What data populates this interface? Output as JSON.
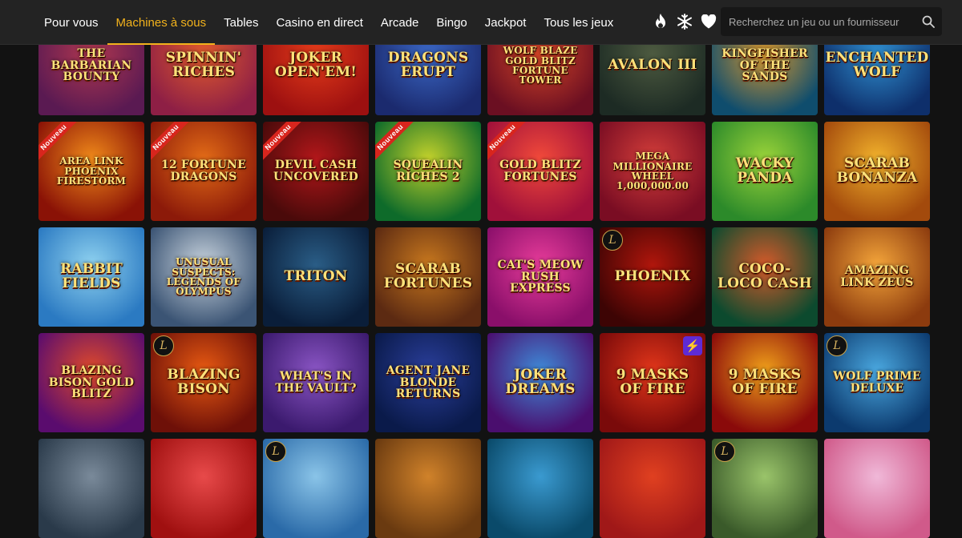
{
  "nav": {
    "items": [
      {
        "label": "Pour vous",
        "active": false
      },
      {
        "label": "Machines à sous",
        "active": true
      },
      {
        "label": "Tables",
        "active": false
      },
      {
        "label": "Casino en direct",
        "active": false
      },
      {
        "label": "Arcade",
        "active": false
      },
      {
        "label": "Bingo",
        "active": false
      },
      {
        "label": "Jackpot",
        "active": false
      },
      {
        "label": "Tous les jeux",
        "active": false
      }
    ]
  },
  "header_icons": [
    "flame-icon",
    "snowflake-icon",
    "heart-icon"
  ],
  "search": {
    "placeholder": "Recherchez un jeu ou un fournisseur",
    "icon": "search-icon"
  },
  "accent_color": "#f2b21c",
  "games": [
    {
      "title": "The Barbarian Bounty",
      "badge": "",
      "bg": "#5a1a52,#b0374f"
    },
    {
      "title": "Spinnin' Riches",
      "badge": "",
      "bg": "#8e1f45,#e05a2c"
    },
    {
      "title": "Joker Open'Em!",
      "badge": "",
      "bg": "#9d1010,#e33b1a"
    },
    {
      "title": "Dragons Erupt",
      "badge": "",
      "bg": "#1b2a6e,#3a66c4"
    },
    {
      "title": "Wolf Blaze Gold Blitz Fortune Tower",
      "badge": "",
      "bg": "#6b0f22,#d24426"
    },
    {
      "title": "Avalon III",
      "badge": "",
      "bg": "#1d2b24,#4d5a40"
    },
    {
      "title": "Kingfisher of the Sands",
      "badge": "",
      "bg": "#0f4d6d,#d8982e"
    },
    {
      "title": "Enchanted Wolf",
      "badge": "",
      "bg": "#0e2f6b,#2f8fd0"
    },
    {
      "title": "Area Link Phoenix Firestorm",
      "badge": "Nouveau",
      "bg": "#8a1206,#f08a1a"
    },
    {
      "title": "12 Fortune Dragons",
      "badge": "Nouveau",
      "bg": "#8c1a09,#e36c17"
    },
    {
      "title": "Devil Cash Uncovered",
      "badge": "Nouveau",
      "bg": "#4a0a0a,#b3171a"
    },
    {
      "title": "Squealin Riches 2",
      "badge": "Nouveau",
      "bg": "#0e6b2a,#c4d22b"
    },
    {
      "title": "Gold Blitz Fortunes",
      "badge": "Nouveau",
      "bg": "#a0103a,#f24a3a"
    },
    {
      "title": "Mega Millionaire Wheel 1,000,000.00",
      "badge": "",
      "bg": "#7a0d23,#d43e3a"
    },
    {
      "title": "Wacky Panda",
      "badge": "",
      "bg": "#2c8a2a,#9bd43a"
    },
    {
      "title": "Scarab Bonanza",
      "badge": "",
      "bg": "#a34a0c,#f2b22c"
    },
    {
      "title": "Rabbit Fields",
      "badge": "",
      "bg": "#2b7ac2,#8fd2f0"
    },
    {
      "title": "Unusual Suspects: Legends of Olympus",
      "badge": "",
      "bg": "#3b5474,#c9d4de"
    },
    {
      "title": "Triton",
      "badge": "",
      "bg": "#0a1e3a,#2a5d86"
    },
    {
      "title": "Scarab Fortunes",
      "badge": "",
      "bg": "#5c2a12,#c8781e"
    },
    {
      "title": "Cat's Meow Rush Express",
      "badge": "",
      "bg": "#8a0f6a,#e83c9a"
    },
    {
      "title": "Phoenix",
      "badge": "L",
      "bg": "#3d0404,#b0160c"
    },
    {
      "title": "Coco-Loco Cash",
      "badge": "",
      "bg": "#0c4a2e,#d45a2a"
    },
    {
      "title": "Amazing Link Zeus",
      "badge": "",
      "bg": "#8c3b0e,#f4a53a"
    },
    {
      "title": "Blazing Bison Gold Blitz",
      "badge": "",
      "bg": "#5a0c6e,#e04a2a"
    },
    {
      "title": "Blazing Bison",
      "badge": "L",
      "bg": "#6e1008,#e85a12"
    },
    {
      "title": "What's in the Vault?",
      "badge": "",
      "bg": "#3b1a6e,#8a55c4"
    },
    {
      "title": "Agent Jane Blonde Returns",
      "badge": "",
      "bg": "#0a1a4a,#2a3e9a"
    },
    {
      "title": "Joker Dreams",
      "badge": "",
      "bg": "#4a0e6e,#3e8ad8"
    },
    {
      "title": "9 Masks of Fire",
      "badge": "bolt",
      "bg": "#7a0a0a,#e2361a"
    },
    {
      "title": "9 Masks of Fire",
      "badge": "",
      "bg": "#8a0a0a,#f0a01a"
    },
    {
      "title": "Wolf Prime Deluxe",
      "badge": "L",
      "bg": "#0c3a6e,#4aa8e0"
    },
    {
      "title": "",
      "badge": "",
      "bg": "#2a3a4a,#7a8a9a"
    },
    {
      "title": "",
      "badge": "",
      "bg": "#a01010,#e84a4a"
    },
    {
      "title": "",
      "badge": "L",
      "bg": "#2a6aa8,#8ac4e8"
    },
    {
      "title": "",
      "badge": "",
      "bg": "#6a3a10,#d0822a"
    },
    {
      "title": "",
      "badge": "",
      "bg": "#0a4a6a,#3a9ad0"
    },
    {
      "title": "",
      "badge": "",
      "bg": "#a01818,#e04020"
    },
    {
      "title": "",
      "badge": "L",
      "bg": "#3a5a2a,#9ac46a"
    },
    {
      "title": "",
      "badge": "",
      "bg": "#d05a8a,#f0b8d8"
    }
  ]
}
